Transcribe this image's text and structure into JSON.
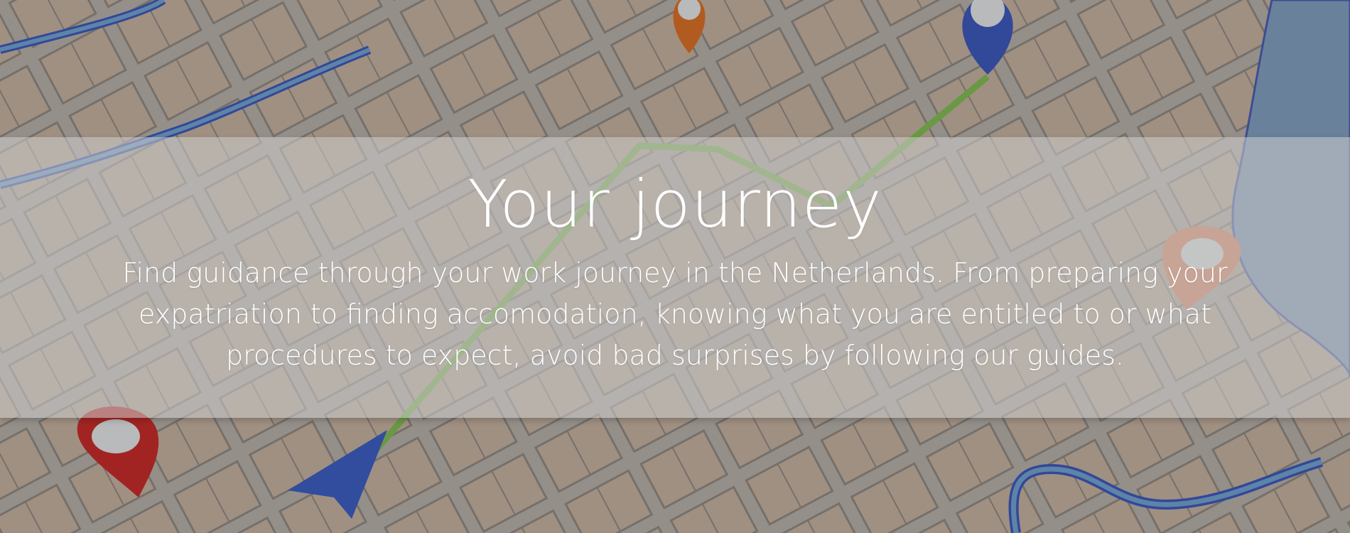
{
  "hero": {
    "title": "Your journey",
    "description": "Find guidance through your work journey in the Netherlands. From preparing your expatriation to finding accomodation, knowing what you are entitled to or what procedures to expect, avoid bad surprises by following our guides."
  },
  "background": {
    "image": "city-map-illustration",
    "route_color": "#7cc04a",
    "water_color": "#6aa3d6",
    "pins": [
      {
        "name": "orange-pin",
        "color": "#e06a1a"
      },
      {
        "name": "blue-pin",
        "color": "#2f4fbf"
      },
      {
        "name": "red-pin",
        "color": "#c81e1e"
      },
      {
        "name": "light-orange-pin",
        "color": "#f08a5d"
      },
      {
        "name": "blue-arrow",
        "color": "#2f55c8"
      }
    ]
  }
}
